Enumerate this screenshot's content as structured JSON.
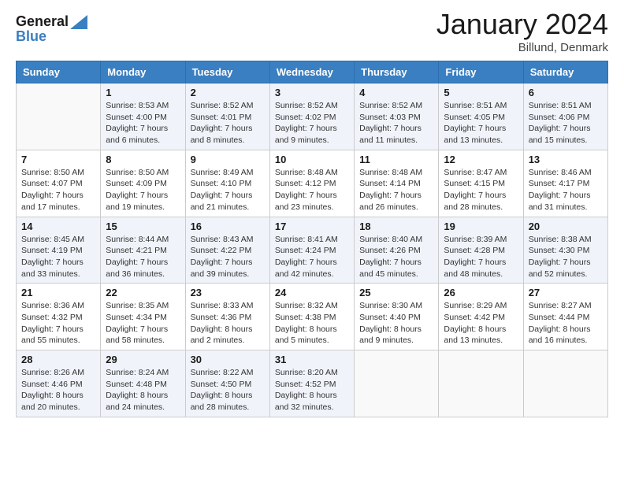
{
  "header": {
    "logo_line1": "General",
    "logo_line2": "Blue",
    "month_title": "January 2024",
    "location": "Billund, Denmark"
  },
  "weekdays": [
    "Sunday",
    "Monday",
    "Tuesday",
    "Wednesday",
    "Thursday",
    "Friday",
    "Saturday"
  ],
  "weeks": [
    [
      {
        "day": "",
        "info": ""
      },
      {
        "day": "1",
        "info": "Sunrise: 8:53 AM\nSunset: 4:00 PM\nDaylight: 7 hours\nand 6 minutes."
      },
      {
        "day": "2",
        "info": "Sunrise: 8:52 AM\nSunset: 4:01 PM\nDaylight: 7 hours\nand 8 minutes."
      },
      {
        "day": "3",
        "info": "Sunrise: 8:52 AM\nSunset: 4:02 PM\nDaylight: 7 hours\nand 9 minutes."
      },
      {
        "day": "4",
        "info": "Sunrise: 8:52 AM\nSunset: 4:03 PM\nDaylight: 7 hours\nand 11 minutes."
      },
      {
        "day": "5",
        "info": "Sunrise: 8:51 AM\nSunset: 4:05 PM\nDaylight: 7 hours\nand 13 minutes."
      },
      {
        "day": "6",
        "info": "Sunrise: 8:51 AM\nSunset: 4:06 PM\nDaylight: 7 hours\nand 15 minutes."
      }
    ],
    [
      {
        "day": "7",
        "info": "Sunrise: 8:50 AM\nSunset: 4:07 PM\nDaylight: 7 hours\nand 17 minutes."
      },
      {
        "day": "8",
        "info": "Sunrise: 8:50 AM\nSunset: 4:09 PM\nDaylight: 7 hours\nand 19 minutes."
      },
      {
        "day": "9",
        "info": "Sunrise: 8:49 AM\nSunset: 4:10 PM\nDaylight: 7 hours\nand 21 minutes."
      },
      {
        "day": "10",
        "info": "Sunrise: 8:48 AM\nSunset: 4:12 PM\nDaylight: 7 hours\nand 23 minutes."
      },
      {
        "day": "11",
        "info": "Sunrise: 8:48 AM\nSunset: 4:14 PM\nDaylight: 7 hours\nand 26 minutes."
      },
      {
        "day": "12",
        "info": "Sunrise: 8:47 AM\nSunset: 4:15 PM\nDaylight: 7 hours\nand 28 minutes."
      },
      {
        "day": "13",
        "info": "Sunrise: 8:46 AM\nSunset: 4:17 PM\nDaylight: 7 hours\nand 31 minutes."
      }
    ],
    [
      {
        "day": "14",
        "info": "Sunrise: 8:45 AM\nSunset: 4:19 PM\nDaylight: 7 hours\nand 33 minutes."
      },
      {
        "day": "15",
        "info": "Sunrise: 8:44 AM\nSunset: 4:21 PM\nDaylight: 7 hours\nand 36 minutes."
      },
      {
        "day": "16",
        "info": "Sunrise: 8:43 AM\nSunset: 4:22 PM\nDaylight: 7 hours\nand 39 minutes."
      },
      {
        "day": "17",
        "info": "Sunrise: 8:41 AM\nSunset: 4:24 PM\nDaylight: 7 hours\nand 42 minutes."
      },
      {
        "day": "18",
        "info": "Sunrise: 8:40 AM\nSunset: 4:26 PM\nDaylight: 7 hours\nand 45 minutes."
      },
      {
        "day": "19",
        "info": "Sunrise: 8:39 AM\nSunset: 4:28 PM\nDaylight: 7 hours\nand 48 minutes."
      },
      {
        "day": "20",
        "info": "Sunrise: 8:38 AM\nSunset: 4:30 PM\nDaylight: 7 hours\nand 52 minutes."
      }
    ],
    [
      {
        "day": "21",
        "info": "Sunrise: 8:36 AM\nSunset: 4:32 PM\nDaylight: 7 hours\nand 55 minutes."
      },
      {
        "day": "22",
        "info": "Sunrise: 8:35 AM\nSunset: 4:34 PM\nDaylight: 7 hours\nand 58 minutes."
      },
      {
        "day": "23",
        "info": "Sunrise: 8:33 AM\nSunset: 4:36 PM\nDaylight: 8 hours\nand 2 minutes."
      },
      {
        "day": "24",
        "info": "Sunrise: 8:32 AM\nSunset: 4:38 PM\nDaylight: 8 hours\nand 5 minutes."
      },
      {
        "day": "25",
        "info": "Sunrise: 8:30 AM\nSunset: 4:40 PM\nDaylight: 8 hours\nand 9 minutes."
      },
      {
        "day": "26",
        "info": "Sunrise: 8:29 AM\nSunset: 4:42 PM\nDaylight: 8 hours\nand 13 minutes."
      },
      {
        "day": "27",
        "info": "Sunrise: 8:27 AM\nSunset: 4:44 PM\nDaylight: 8 hours\nand 16 minutes."
      }
    ],
    [
      {
        "day": "28",
        "info": "Sunrise: 8:26 AM\nSunset: 4:46 PM\nDaylight: 8 hours\nand 20 minutes."
      },
      {
        "day": "29",
        "info": "Sunrise: 8:24 AM\nSunset: 4:48 PM\nDaylight: 8 hours\nand 24 minutes."
      },
      {
        "day": "30",
        "info": "Sunrise: 8:22 AM\nSunset: 4:50 PM\nDaylight: 8 hours\nand 28 minutes."
      },
      {
        "day": "31",
        "info": "Sunrise: 8:20 AM\nSunset: 4:52 PM\nDaylight: 8 hours\nand 32 minutes."
      },
      {
        "day": "",
        "info": ""
      },
      {
        "day": "",
        "info": ""
      },
      {
        "day": "",
        "info": ""
      }
    ]
  ]
}
